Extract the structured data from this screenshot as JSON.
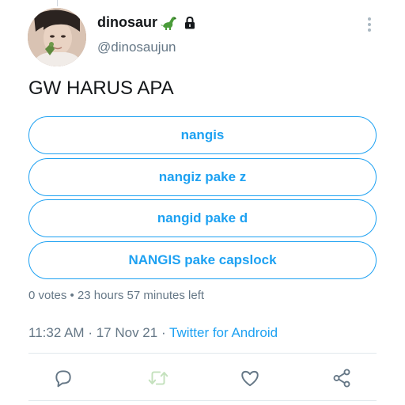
{
  "tweet": {
    "display_name": "dinosaur",
    "name_emoji": "dinosaur-icon",
    "protected_icon": "lock-icon",
    "handle": "@dinosaujun",
    "text": "GW HARUS APA",
    "poll": {
      "options": [
        "nangis",
        "nangiz pake z",
        "nangid pake d",
        "NANGIS pake capslock"
      ],
      "meta": "0 votes • 23 hours 57 minutes left"
    },
    "time": "11:32 AM",
    "date": "17 Nov 21",
    "separator": "·",
    "source": "Twitter for Android"
  },
  "actions": {
    "icons": [
      "reply-icon",
      "retweet-icon",
      "like-icon",
      "share-icon"
    ]
  },
  "colors": {
    "accent": "#1da1f2",
    "secondary_text": "#657786",
    "primary_text": "#14171a",
    "retweet_disabled": "#c4e1bd",
    "divider": "#e1e8ed"
  }
}
